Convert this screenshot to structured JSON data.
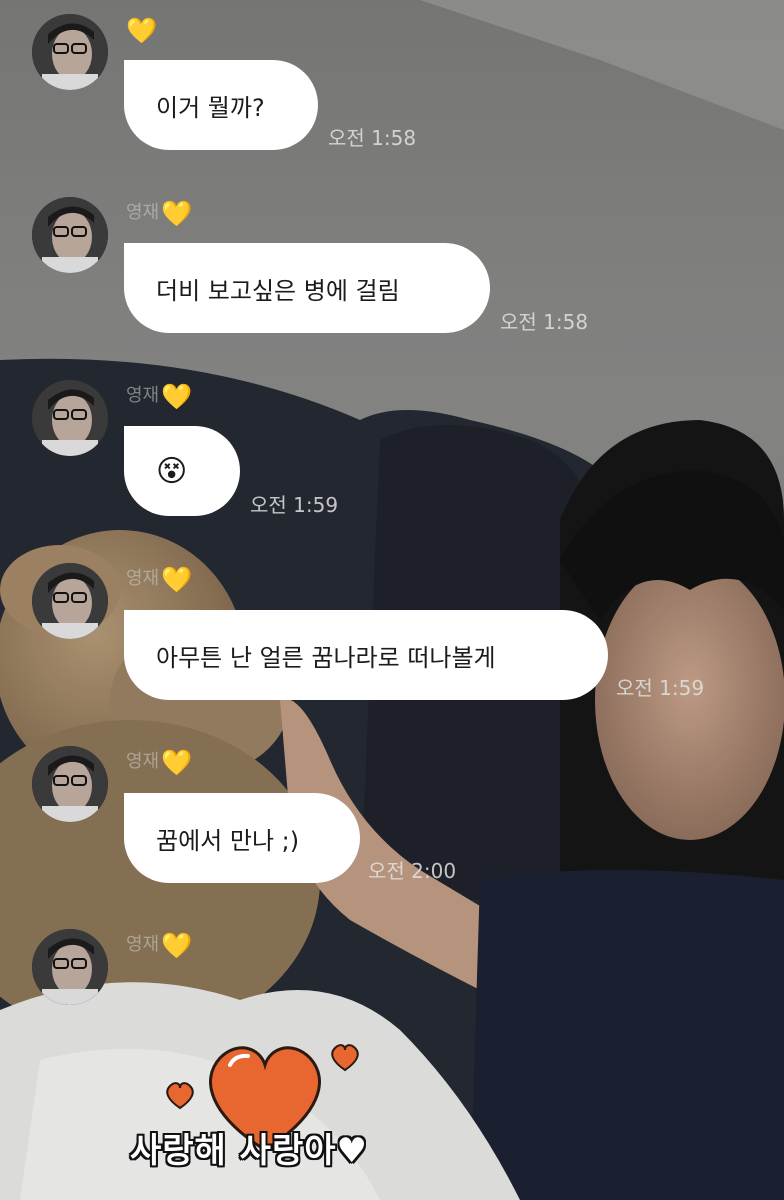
{
  "sender": {
    "name": "영재",
    "heart": "💛",
    "heart_color": "#f5c431"
  },
  "messages": [
    {
      "text": "이거 뭘까?",
      "time": "오전 1:58",
      "show_name": false
    },
    {
      "text": "더비 보고싶은 병에 걸림",
      "time": "오전 1:58",
      "show_name": true
    },
    {
      "text": "😵",
      "time": "오전 1:59",
      "show_name": true
    },
    {
      "text": "아무튼 난 얼른 꿈나라로 떠나볼게",
      "time": "오전 1:59",
      "show_name": true
    },
    {
      "text": "꿈에서 만나 ;)",
      "time": "오전 2:00",
      "show_name": true
    }
  ],
  "last_sender": {
    "name": "영재"
  },
  "sticker": {
    "text": "사랑해 사랑아♥",
    "heart_color": "#e8662f"
  },
  "colors": {
    "bubble": "#ffffff",
    "background": "#7b7b7b"
  }
}
